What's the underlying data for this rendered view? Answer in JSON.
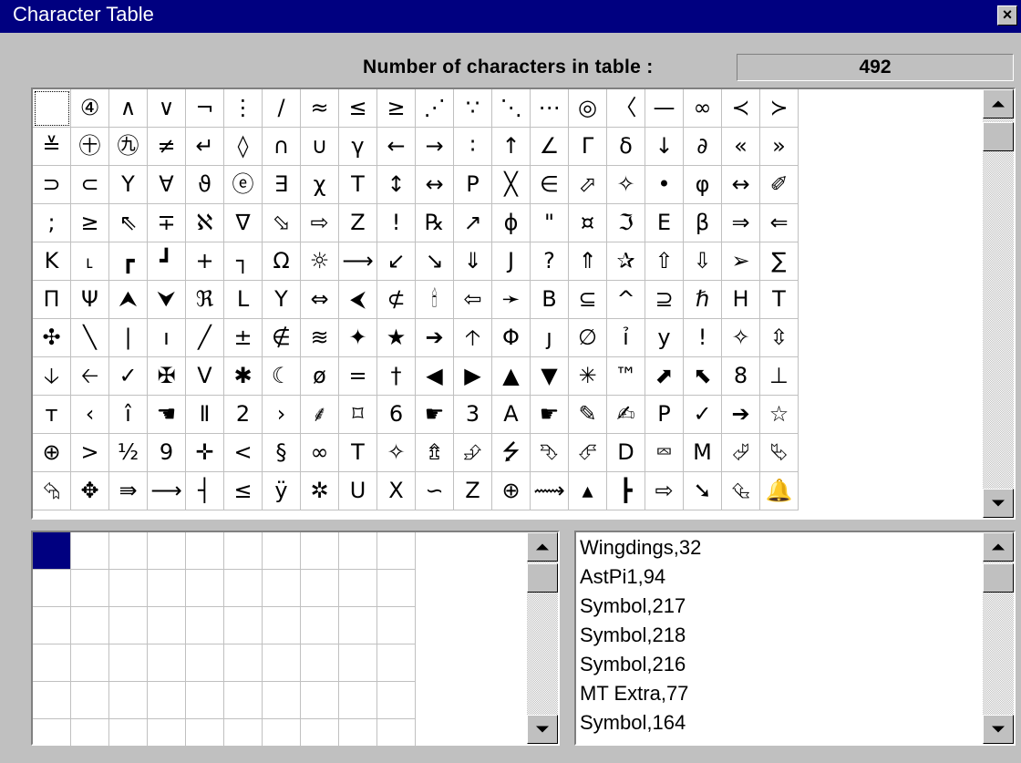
{
  "window": {
    "title": "Character Table",
    "close_label": "×"
  },
  "counter": {
    "label": "Number of characters in table :",
    "value": "492"
  },
  "char_grid": {
    "rows": [
      [
        "",
        "④",
        "∧",
        "∨",
        "¬",
        "⋮",
        "/",
        "≈",
        "≤",
        "≥",
        "⋰",
        "∵",
        "⋱",
        "⋯",
        "◎",
        "〈",
        "—",
        "∞",
        "≺",
        "≻"
      ],
      [
        "≚",
        "㊉",
        "㊈",
        "≠",
        "↵",
        "◊",
        "∩",
        "∪",
        "γ",
        "←",
        "→",
        "∶",
        "↑",
        "∠",
        "Γ",
        "δ",
        "↓",
        "∂",
        "«",
        "»"
      ],
      [
        "⊃",
        "⊂",
        "Y",
        "∀",
        "ϑ",
        "ⓔ",
        "∃",
        "χ",
        "T",
        "↕",
        "↔",
        "P",
        "╳",
        "∈",
        "⬀",
        "✧",
        "•",
        "φ",
        "↔",
        "✐"
      ],
      [
        ";",
        "≥",
        "⇖",
        "∓",
        "ℵ",
        "∇",
        "⬂",
        "⇨",
        "Z",
        "!",
        "℞",
        "↗",
        "ϕ",
        "\"",
        "¤",
        "ℑ",
        "E",
        "β",
        "⇒",
        "⇐"
      ],
      [
        "K",
        "˪",
        "┏",
        "┛",
        "+",
        "┐",
        "Ω",
        "☼",
        "⟶",
        "↙",
        "↘",
        "⇓",
        "J",
        "?",
        "⇑",
        "✰",
        "⇧",
        "⇩",
        "➢",
        "∑"
      ],
      [
        "Π",
        "Ψ",
        "⮝",
        "⮟",
        "ℜ",
        "L",
        "Y",
        "⇔",
        "⮜",
        "⊄",
        "🕯",
        "⇦",
        "➛",
        "B",
        "⊆",
        "^",
        "⊇",
        "ℏ",
        "H",
        "T"
      ],
      [
        "✣",
        "╲",
        "|",
        "ı",
        "╱",
        "±",
        "∉",
        "≋",
        "✦",
        "★",
        "➔",
        "🡡",
        "Φ",
        "ȷ",
        "∅",
        "ỉ",
        "y",
        "!",
        "✧",
        "⇳"
      ],
      [
        "🡣",
        "🡠",
        "✓",
        "✠",
        "V",
        "✱",
        "☾",
        "ø",
        "=",
        "†",
        "◀",
        "▶",
        "▲",
        "▼",
        "✳",
        "™",
        "⬈",
        "⬉",
        "8",
        "⊥"
      ],
      [
        "т",
        "‹",
        "î",
        "☚",
        "Ⅱ",
        "2",
        "›",
        "⸙",
        "⌑",
        "6",
        "☛",
        "3",
        "A",
        "☛",
        "✎",
        "✍",
        "P",
        "✓",
        "➔",
        "☆"
      ],
      [
        "⊕",
        ">",
        "½",
        "9",
        "✛",
        "<",
        "§",
        "∞",
        "T",
        "✧",
        "⇯",
        "⮵",
        "⭍",
        "⮷",
        "⮶",
        "D",
        "⮹",
        "M",
        "⮰",
        "⮱"
      ],
      [
        "⮲",
        "✥",
        "⇛",
        "⟶",
        "┤",
        "≤",
        "ÿ",
        "✲",
        "U",
        "X",
        "∽",
        "Z",
        "⊕",
        "⟿",
        "▴",
        "┣",
        "⇨",
        "➘",
        "⮴",
        "🔔"
      ]
    ]
  },
  "font_list": {
    "items": [
      "Wingdings,32",
      "AstPi1,94",
      "Symbol,217",
      "Symbol,218",
      "Symbol,216",
      "MT Extra,77",
      "Symbol,164"
    ]
  }
}
